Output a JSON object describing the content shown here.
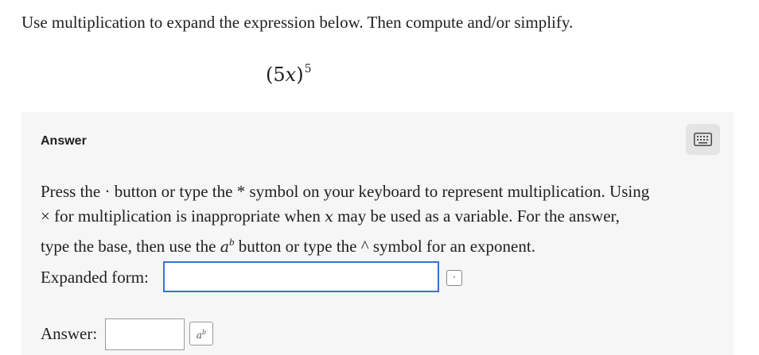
{
  "question": {
    "prompt": "Use multiplication to expand the expression below. Then compute and/or simplify.",
    "expression": {
      "open": "(5",
      "variable": "x",
      "close": ")",
      "exponent": "5"
    }
  },
  "answer_section": {
    "heading": "Answer",
    "keyboard_icon": "keyboard-icon",
    "instructions": {
      "line1": "Press the · button or type the * symbol on your keyboard to represent multiplication. Using",
      "line2_a": "× for multiplication is inappropriate when ",
      "line2_var": "x",
      "line2_b": " may be used as a variable. For the answer,",
      "line3_a": "type the base, then use the ",
      "line3_base": "a",
      "line3_exp": "b",
      "line3_b": " button or type the ^ symbol for an exponent."
    },
    "expanded_form": {
      "label": "Expanded form:",
      "value": "",
      "button_label": "·"
    },
    "final_answer": {
      "label": "Answer:",
      "value": "",
      "button_base": "a",
      "button_exp": "b"
    }
  },
  "colors": {
    "panel_background": "#f6f6f6",
    "focused_input_border": "#3b6fd4",
    "keyboard_button_background": "#e4e4e4"
  }
}
